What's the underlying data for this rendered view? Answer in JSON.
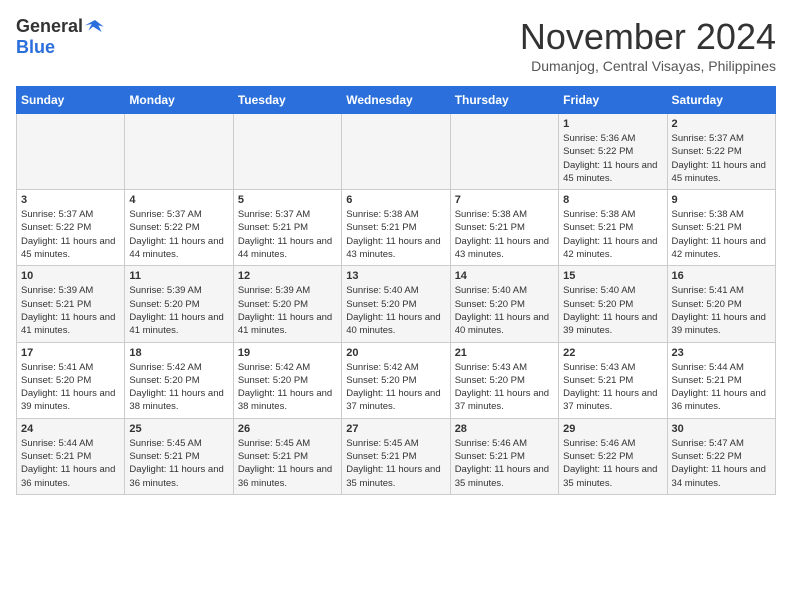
{
  "header": {
    "logo_general": "General",
    "logo_blue": "Blue",
    "month_title": "November 2024",
    "location": "Dumanjog, Central Visayas, Philippines"
  },
  "calendar": {
    "headers": [
      "Sunday",
      "Monday",
      "Tuesday",
      "Wednesday",
      "Thursday",
      "Friday",
      "Saturday"
    ],
    "weeks": [
      [
        {
          "day": "",
          "sunrise": "",
          "sunset": "",
          "daylight": ""
        },
        {
          "day": "",
          "sunrise": "",
          "sunset": "",
          "daylight": ""
        },
        {
          "day": "",
          "sunrise": "",
          "sunset": "",
          "daylight": ""
        },
        {
          "day": "",
          "sunrise": "",
          "sunset": "",
          "daylight": ""
        },
        {
          "day": "",
          "sunrise": "",
          "sunset": "",
          "daylight": ""
        },
        {
          "day": "1",
          "sunrise": "5:36 AM",
          "sunset": "5:22 PM",
          "daylight": "11 hours and 45 minutes."
        },
        {
          "day": "2",
          "sunrise": "5:37 AM",
          "sunset": "5:22 PM",
          "daylight": "11 hours and 45 minutes."
        }
      ],
      [
        {
          "day": "3",
          "sunrise": "5:37 AM",
          "sunset": "5:22 PM",
          "daylight": "11 hours and 45 minutes."
        },
        {
          "day": "4",
          "sunrise": "5:37 AM",
          "sunset": "5:22 PM",
          "daylight": "11 hours and 44 minutes."
        },
        {
          "day": "5",
          "sunrise": "5:37 AM",
          "sunset": "5:21 PM",
          "daylight": "11 hours and 44 minutes."
        },
        {
          "day": "6",
          "sunrise": "5:38 AM",
          "sunset": "5:21 PM",
          "daylight": "11 hours and 43 minutes."
        },
        {
          "day": "7",
          "sunrise": "5:38 AM",
          "sunset": "5:21 PM",
          "daylight": "11 hours and 43 minutes."
        },
        {
          "day": "8",
          "sunrise": "5:38 AM",
          "sunset": "5:21 PM",
          "daylight": "11 hours and 42 minutes."
        },
        {
          "day": "9",
          "sunrise": "5:38 AM",
          "sunset": "5:21 PM",
          "daylight": "11 hours and 42 minutes."
        }
      ],
      [
        {
          "day": "10",
          "sunrise": "5:39 AM",
          "sunset": "5:21 PM",
          "daylight": "11 hours and 41 minutes."
        },
        {
          "day": "11",
          "sunrise": "5:39 AM",
          "sunset": "5:20 PM",
          "daylight": "11 hours and 41 minutes."
        },
        {
          "day": "12",
          "sunrise": "5:39 AM",
          "sunset": "5:20 PM",
          "daylight": "11 hours and 41 minutes."
        },
        {
          "day": "13",
          "sunrise": "5:40 AM",
          "sunset": "5:20 PM",
          "daylight": "11 hours and 40 minutes."
        },
        {
          "day": "14",
          "sunrise": "5:40 AM",
          "sunset": "5:20 PM",
          "daylight": "11 hours and 40 minutes."
        },
        {
          "day": "15",
          "sunrise": "5:40 AM",
          "sunset": "5:20 PM",
          "daylight": "11 hours and 39 minutes."
        },
        {
          "day": "16",
          "sunrise": "5:41 AM",
          "sunset": "5:20 PM",
          "daylight": "11 hours and 39 minutes."
        }
      ],
      [
        {
          "day": "17",
          "sunrise": "5:41 AM",
          "sunset": "5:20 PM",
          "daylight": "11 hours and 39 minutes."
        },
        {
          "day": "18",
          "sunrise": "5:42 AM",
          "sunset": "5:20 PM",
          "daylight": "11 hours and 38 minutes."
        },
        {
          "day": "19",
          "sunrise": "5:42 AM",
          "sunset": "5:20 PM",
          "daylight": "11 hours and 38 minutes."
        },
        {
          "day": "20",
          "sunrise": "5:42 AM",
          "sunset": "5:20 PM",
          "daylight": "11 hours and 37 minutes."
        },
        {
          "day": "21",
          "sunrise": "5:43 AM",
          "sunset": "5:20 PM",
          "daylight": "11 hours and 37 minutes."
        },
        {
          "day": "22",
          "sunrise": "5:43 AM",
          "sunset": "5:21 PM",
          "daylight": "11 hours and 37 minutes."
        },
        {
          "day": "23",
          "sunrise": "5:44 AM",
          "sunset": "5:21 PM",
          "daylight": "11 hours and 36 minutes."
        }
      ],
      [
        {
          "day": "24",
          "sunrise": "5:44 AM",
          "sunset": "5:21 PM",
          "daylight": "11 hours and 36 minutes."
        },
        {
          "day": "25",
          "sunrise": "5:45 AM",
          "sunset": "5:21 PM",
          "daylight": "11 hours and 36 minutes."
        },
        {
          "day": "26",
          "sunrise": "5:45 AM",
          "sunset": "5:21 PM",
          "daylight": "11 hours and 36 minutes."
        },
        {
          "day": "27",
          "sunrise": "5:45 AM",
          "sunset": "5:21 PM",
          "daylight": "11 hours and 35 minutes."
        },
        {
          "day": "28",
          "sunrise": "5:46 AM",
          "sunset": "5:21 PM",
          "daylight": "11 hours and 35 minutes."
        },
        {
          "day": "29",
          "sunrise": "5:46 AM",
          "sunset": "5:22 PM",
          "daylight": "11 hours and 35 minutes."
        },
        {
          "day": "30",
          "sunrise": "5:47 AM",
          "sunset": "5:22 PM",
          "daylight": "11 hours and 34 minutes."
        }
      ]
    ]
  }
}
